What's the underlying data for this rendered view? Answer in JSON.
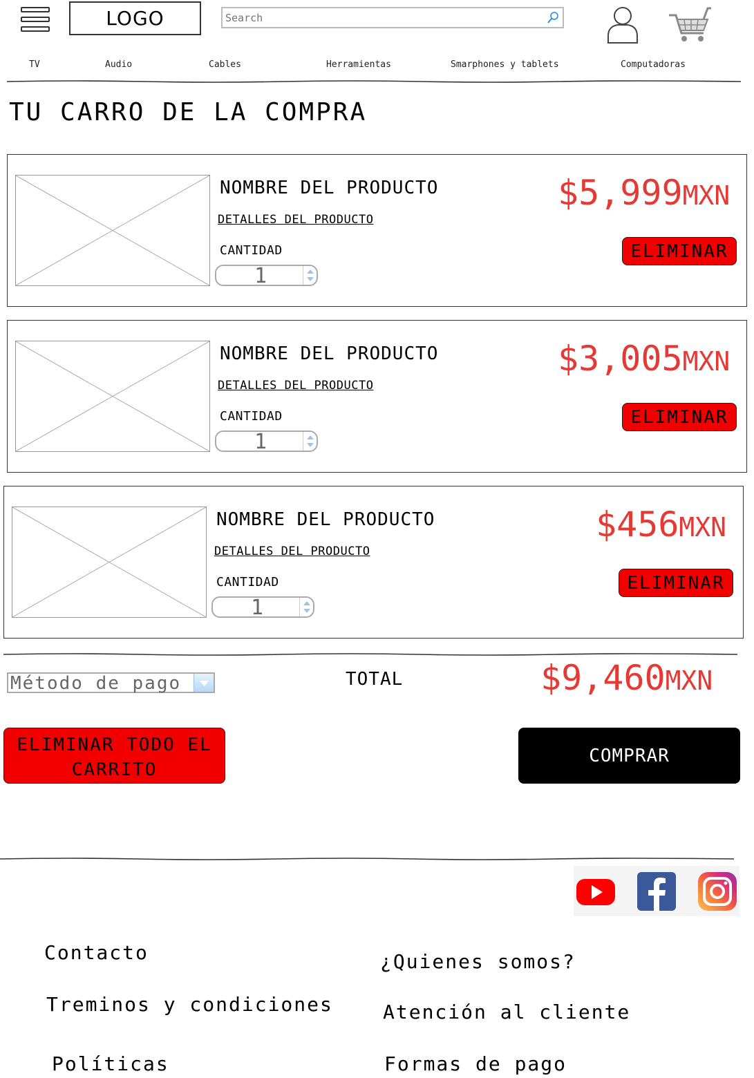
{
  "header": {
    "logo_text": "LOGO",
    "search_placeholder": "Search"
  },
  "nav": {
    "items": [
      "TV",
      "Audio",
      "Cables",
      "Herramientas",
      "Smarphones y tablets",
      "Computadoras"
    ]
  },
  "page_title": "TU CARRO DE LA COMPRA",
  "cart": {
    "items": [
      {
        "name": "NOMBRE DEL PRODUCTO",
        "details_link": "DETALLES DEL PRODUCTO",
        "quantity_label": "CANTIDAD",
        "quantity": "1",
        "price": "$5,999",
        "currency": "MXN",
        "remove_label": "ELIMINAR"
      },
      {
        "name": "NOMBRE DEL PRODUCTO",
        "details_link": "DETALLES DEL PRODUCTO",
        "quantity_label": "CANTIDAD",
        "quantity": "1",
        "price": "$3,005",
        "currency": "MXN",
        "remove_label": "ELIMINAR"
      },
      {
        "name": "NOMBRE DEL PRODUCTO",
        "details_link": "DETALLES DEL PRODUCTO",
        "quantity_label": "CANTIDAD",
        "quantity": "1",
        "price": "$456",
        "currency": "MXN",
        "remove_label": "ELIMINAR"
      }
    ]
  },
  "summary": {
    "payment_method_selected": "Método de pago",
    "total_label": "TOTAL",
    "total_price": "$9,460",
    "total_currency": "MXN",
    "clear_cart_line1": "ELIMINAR TODO EL",
    "clear_cart_line2": "CARRITO",
    "buy_label": "COMPRAR"
  },
  "footer": {
    "links_left": [
      "Contacto",
      "Treminos y condiciones",
      "Políticas"
    ],
    "links_right": [
      "¿Quienes somos?",
      "Atención al cliente",
      "Formas de pago"
    ],
    "social_icons": [
      "youtube-icon",
      "facebook-icon",
      "instagram-icon"
    ]
  },
  "colors": {
    "price_red": "#e53935",
    "button_red": "#f20000",
    "buy_black": "#000000",
    "youtube": "#ff0000",
    "facebook": "#3b5998"
  }
}
